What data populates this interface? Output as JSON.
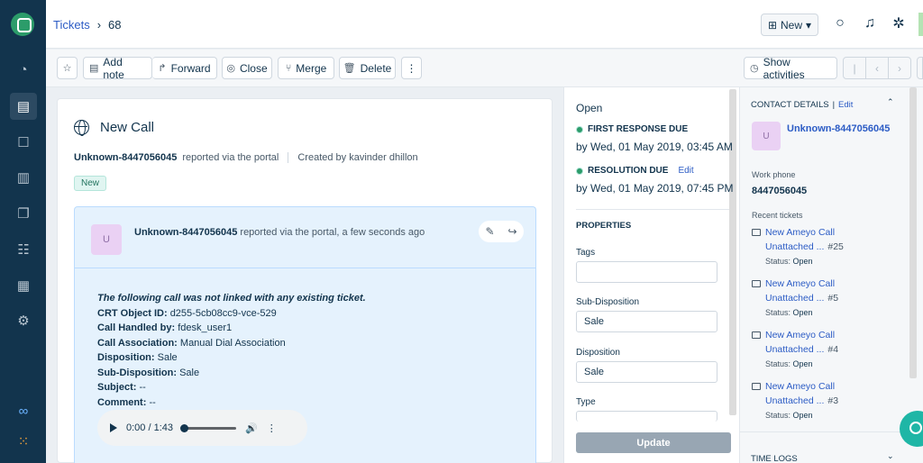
{
  "breadcrumb": {
    "section": "Tickets",
    "ticket_no": "68"
  },
  "topbar": {
    "new_label": "New"
  },
  "toolbar": {
    "add_note": "Add note",
    "forward": "Forward",
    "close": "Close",
    "merge": "Merge",
    "delete": "Delete",
    "more": "⋮",
    "show_activities": "Show activities"
  },
  "ticket": {
    "title": "New Call",
    "requester": "Unknown-8447056045",
    "via": "reported via the portal",
    "created_by": "Created by kavinder dhillon",
    "status_badge": "New"
  },
  "conversation": {
    "avatar": "U",
    "author": "Unknown-8447056045",
    "meta": "reported via the portal, a few seconds ago",
    "intro": "The following call was not linked with any existing ticket.",
    "fields": [
      {
        "label": "CRT Object ID:",
        "value": "d255-5cb08cc9-vce-529"
      },
      {
        "label": "Call Handled by:",
        "value": "fdesk_user1"
      },
      {
        "label": "Call Association:",
        "value": "Manual Dial Association"
      },
      {
        "label": "Disposition:",
        "value": "Sale"
      },
      {
        "label": "Sub-Disposition:",
        "value": "Sale"
      },
      {
        "label": "Subject:",
        "value": "--"
      },
      {
        "label": "Comment:",
        "value": "--"
      }
    ],
    "audio_time": "0:00 / 1:43"
  },
  "properties": {
    "status": "Open",
    "first_response_label": "FIRST RESPONSE DUE",
    "first_response_value": "by Wed, 01 May 2019, 03:45 AM",
    "resolution_label": "RESOLUTION DUE",
    "resolution_edit": "Edit",
    "resolution_value": "by Wed, 01 May 2019, 07:45 PM",
    "heading": "PROPERTIES",
    "tags_label": "Tags",
    "tags_value": "",
    "subdisp_label": "Sub-Disposition",
    "subdisp_value": "Sale",
    "disp_label": "Disposition",
    "disp_value": "Sale",
    "type_label": "Type",
    "update_label": "Update"
  },
  "contact": {
    "heading": "CONTACT DETAILS",
    "edit": "Edit",
    "avatar": "U",
    "name": "Unknown-8447056045",
    "phone_label": "Work phone",
    "phone_value": "8447056045",
    "recent_label": "Recent tickets",
    "recent": [
      {
        "title": "New Ameyo Call",
        "group": "Unattached ...",
        "num": "#25",
        "status_label": "Status:",
        "status": "Open"
      },
      {
        "title": "New Ameyo Call",
        "group": "Unattached ...",
        "num": "#5",
        "status_label": "Status:",
        "status": "Open"
      },
      {
        "title": "New Ameyo Call",
        "group": "Unattached ...",
        "num": "#4",
        "status_label": "Status:",
        "status": "Open"
      },
      {
        "title": "New Ameyo Call",
        "group": "Unattached ...",
        "num": "#3",
        "status_label": "Status:",
        "status": "Open"
      }
    ],
    "time_logs": "TIME LOGS"
  },
  "colors": {
    "nav": "#12344d",
    "link": "#2c5cc5",
    "accent": "#2c9c6a",
    "conv_bg": "#e5f2fd"
  }
}
